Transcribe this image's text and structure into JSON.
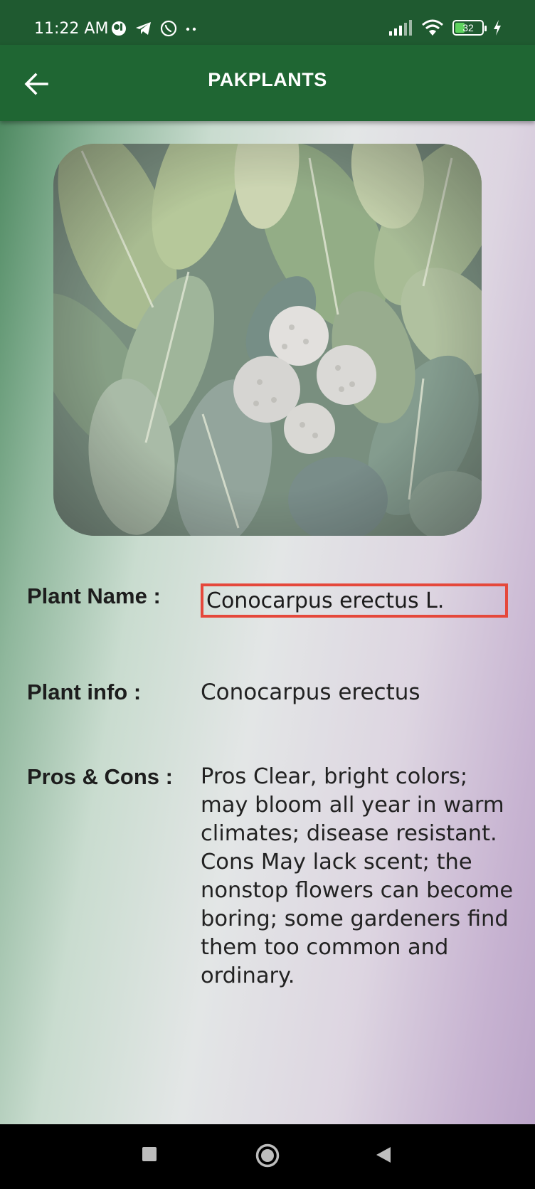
{
  "status_bar": {
    "time": "11:22 AM",
    "battery": "32",
    "left_icons": [
      "profile-circle-icon",
      "telegram-icon",
      "whatsapp-icon",
      "more-dots-icon"
    ],
    "right_icons": [
      "signal-icon",
      "wifi-icon",
      "battery-icon",
      "charging-icon"
    ]
  },
  "app_bar": {
    "title": "PAKPLANTS",
    "back_icon": "arrow-back-icon",
    "color": "#1f6633"
  },
  "plant": {
    "photo": "plant-photo",
    "name_label": "Plant Name :",
    "name_value": "Conocarpus erectus L.",
    "info_label": "Plant info :",
    "info_value": "Conocarpus erectus",
    "pros_label": "Pros & Cons :",
    "pros_value": "Pros Clear, bright colors; may bloom all year in warm climates; disease resistant. Cons May lack scent; the nonstop flowers can become boring; some gardeners find them too common and ordinary."
  },
  "highlight_color": "#e5483b",
  "nav_bar": {
    "buttons": [
      "recents-square-icon",
      "home-circle-icon",
      "back-triangle-icon"
    ]
  }
}
